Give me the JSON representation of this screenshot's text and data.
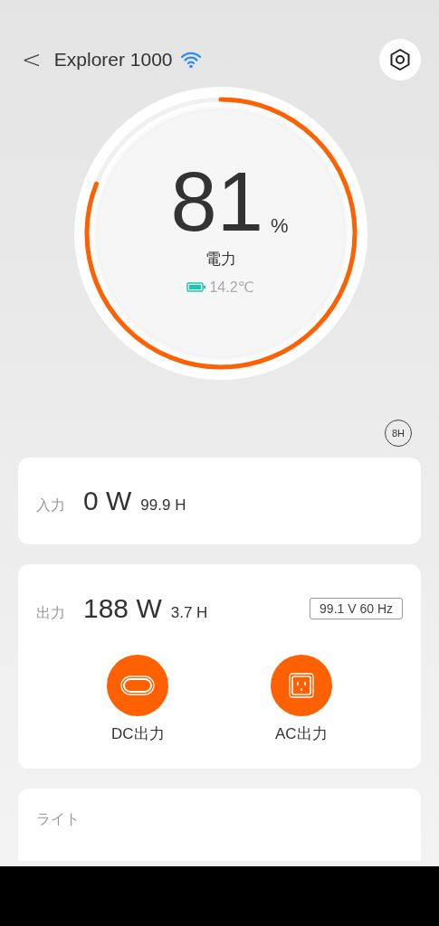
{
  "header": {
    "back": "<",
    "title": "Explorer 1000"
  },
  "battery": {
    "percent": "81",
    "unit": "%",
    "label": "電力",
    "temperature": "14.2℃"
  },
  "timer_badge": "8H",
  "input": {
    "label": "入力",
    "power": "0 W",
    "time": "99.9 H"
  },
  "output": {
    "label": "出力",
    "power": "188 W",
    "time": "3.7 H",
    "reading": "99.1 V 60 Hz",
    "ports": [
      {
        "kind": "dc",
        "label": "DC出力",
        "on": true
      },
      {
        "kind": "ac",
        "label": "AC出力",
        "on": true
      }
    ]
  },
  "light": {
    "label": "ライト"
  }
}
